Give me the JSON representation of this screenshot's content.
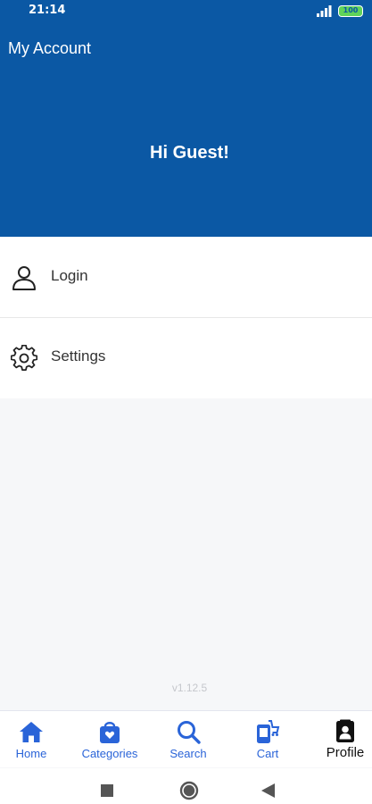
{
  "status_bar": {
    "time": "21:14",
    "battery": "100"
  },
  "header": {
    "title": "My Account",
    "greeting": "Hi Guest!"
  },
  "menu": {
    "items": [
      {
        "label": "Login",
        "icon": "person-icon"
      },
      {
        "label": "Settings",
        "icon": "gear-icon"
      }
    ]
  },
  "version": "v1.12.5",
  "tabbar": {
    "tabs": [
      {
        "label": "Home",
        "icon": "home-icon",
        "active": false
      },
      {
        "label": "Categories",
        "icon": "shopping-bag-icon",
        "active": false
      },
      {
        "label": "Search",
        "icon": "search-icon",
        "active": false
      },
      {
        "label": "Cart",
        "icon": "cart-icon",
        "active": false
      },
      {
        "label": "Profile",
        "icon": "profile-icon",
        "active": true
      }
    ]
  },
  "colors": {
    "header_bg": "#0b58a4",
    "tab_accent": "#2a64d8",
    "background": "#f6f7f9"
  }
}
